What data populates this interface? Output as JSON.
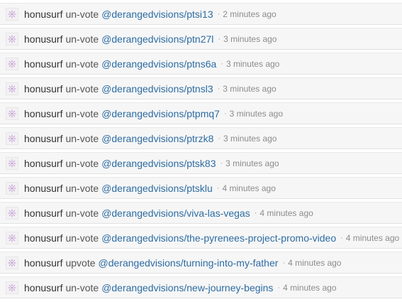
{
  "feed": {
    "separator": "·",
    "items": [
      {
        "user": "honusurf",
        "action": "un-vote",
        "target": "@derangedvisions/ptsi13",
        "time": "2 minutes ago"
      },
      {
        "user": "honusurf",
        "action": "un-vote",
        "target": "@derangedvisions/ptn27l",
        "time": "3 minutes ago"
      },
      {
        "user": "honusurf",
        "action": "un-vote",
        "target": "@derangedvisions/ptns6a",
        "time": "3 minutes ago"
      },
      {
        "user": "honusurf",
        "action": "un-vote",
        "target": "@derangedvisions/ptnsl3",
        "time": "3 minutes ago"
      },
      {
        "user": "honusurf",
        "action": "un-vote",
        "target": "@derangedvisions/ptpmq7",
        "time": "3 minutes ago"
      },
      {
        "user": "honusurf",
        "action": "un-vote",
        "target": "@derangedvisions/ptrzk8",
        "time": "3 minutes ago"
      },
      {
        "user": "honusurf",
        "action": "un-vote",
        "target": "@derangedvisions/ptsk83",
        "time": "3 minutes ago"
      },
      {
        "user": "honusurf",
        "action": "un-vote",
        "target": "@derangedvisions/ptsklu",
        "time": "4 minutes ago"
      },
      {
        "user": "honusurf",
        "action": "un-vote",
        "target": "@derangedvisions/viva-las-vegas",
        "time": "4 minutes ago"
      },
      {
        "user": "honusurf",
        "action": "un-vote",
        "target": "@derangedvisions/the-pyrenees-project-promo-video",
        "time": "4 minutes ago"
      },
      {
        "user": "honusurf",
        "action": "upvote",
        "target": "@derangedvisions/turning-into-my-father",
        "time": "4 minutes ago"
      },
      {
        "user": "honusurf",
        "action": "un-vote",
        "target": "@derangedvisions/new-journey-begins",
        "time": "4 minutes ago"
      }
    ]
  },
  "colors": {
    "link": "#2d6ca2",
    "row_background": "#f6f6f6",
    "avatar_accent": "#c9a6d6"
  },
  "icons": {
    "avatar": "user-avatar-icon"
  }
}
